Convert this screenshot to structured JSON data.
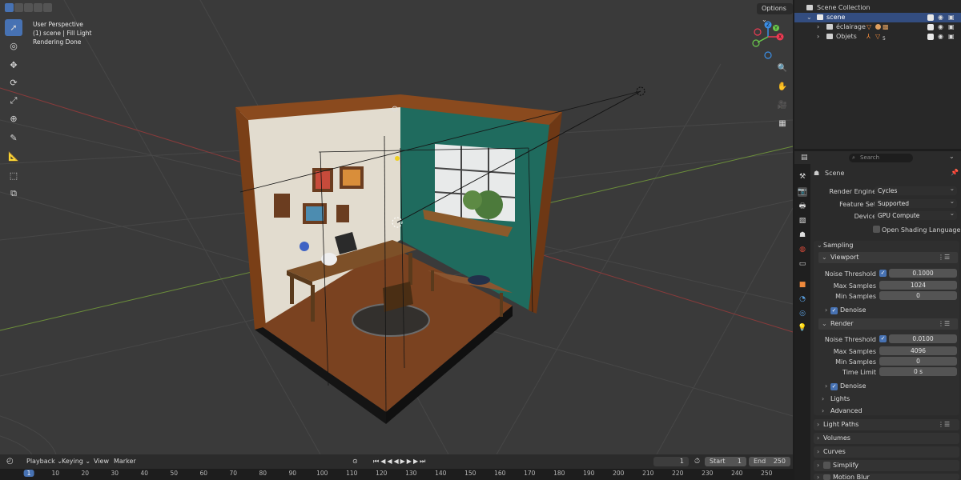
{
  "viewport": {
    "overlay": [
      "User Perspective",
      "(1) scene | Fill Light",
      "Rendering Done"
    ],
    "options_label": "Options",
    "tools": [
      "select-box",
      "cursor",
      "move",
      "rotate",
      "scale",
      "transform",
      "annotate",
      "measure",
      "add-cube",
      "add-object"
    ]
  },
  "gizmo": {
    "x_color": "#ed3b53",
    "y_color": "#6ac94c",
    "z_color": "#3b8fe7"
  },
  "timeline": {
    "menus": [
      "Playback",
      "Keying",
      "View",
      "Marker"
    ],
    "current_frame": "1",
    "start_label": "Start",
    "start_value": "1",
    "end_label": "End",
    "end_value": "250",
    "ruler": [
      "1",
      "10",
      "20",
      "30",
      "40",
      "50",
      "60",
      "70",
      "80",
      "90",
      "100",
      "110",
      "120",
      "130",
      "140",
      "150",
      "160",
      "170",
      "180",
      "190",
      "200",
      "210",
      "220",
      "230",
      "240",
      "250"
    ]
  },
  "outliner": {
    "root": "Scene Collection",
    "items": [
      {
        "label": "scene",
        "selected": true
      },
      {
        "label": "éclairage",
        "badge": ""
      },
      {
        "label": "Objets",
        "badge": "5"
      }
    ]
  },
  "properties": {
    "search_placeholder": "Search",
    "scene_label": "Scene",
    "render_engine_label": "Render Engine",
    "render_engine_value": "Cycles",
    "feature_set_label": "Feature Set",
    "feature_set_value": "Supported",
    "device_label": "Device",
    "device_value": "GPU Compute",
    "osl_label": "Open Shading Language",
    "sampling": {
      "title": "Sampling",
      "viewport_title": "Viewport",
      "vp_noise_label": "Noise Threshold",
      "vp_noise_value": "0.1000",
      "vp_max_label": "Max Samples",
      "vp_max_value": "1024",
      "vp_min_label": "Min Samples",
      "vp_min_value": "0",
      "vp_denoise_label": "Denoise",
      "render_title": "Render",
      "r_noise_label": "Noise Threshold",
      "r_noise_value": "0.0100",
      "r_max_label": "Max Samples",
      "r_max_value": "4096",
      "r_min_label": "Min Samples",
      "r_min_value": "0",
      "r_time_label": "Time Limit",
      "r_time_value": "0 s",
      "r_denoise_label": "Denoise",
      "lights_label": "Lights",
      "advanced_label": "Advanced"
    },
    "panels": [
      "Light Paths",
      "Volumes",
      "Curves",
      "Simplify",
      "Motion Blur"
    ]
  }
}
